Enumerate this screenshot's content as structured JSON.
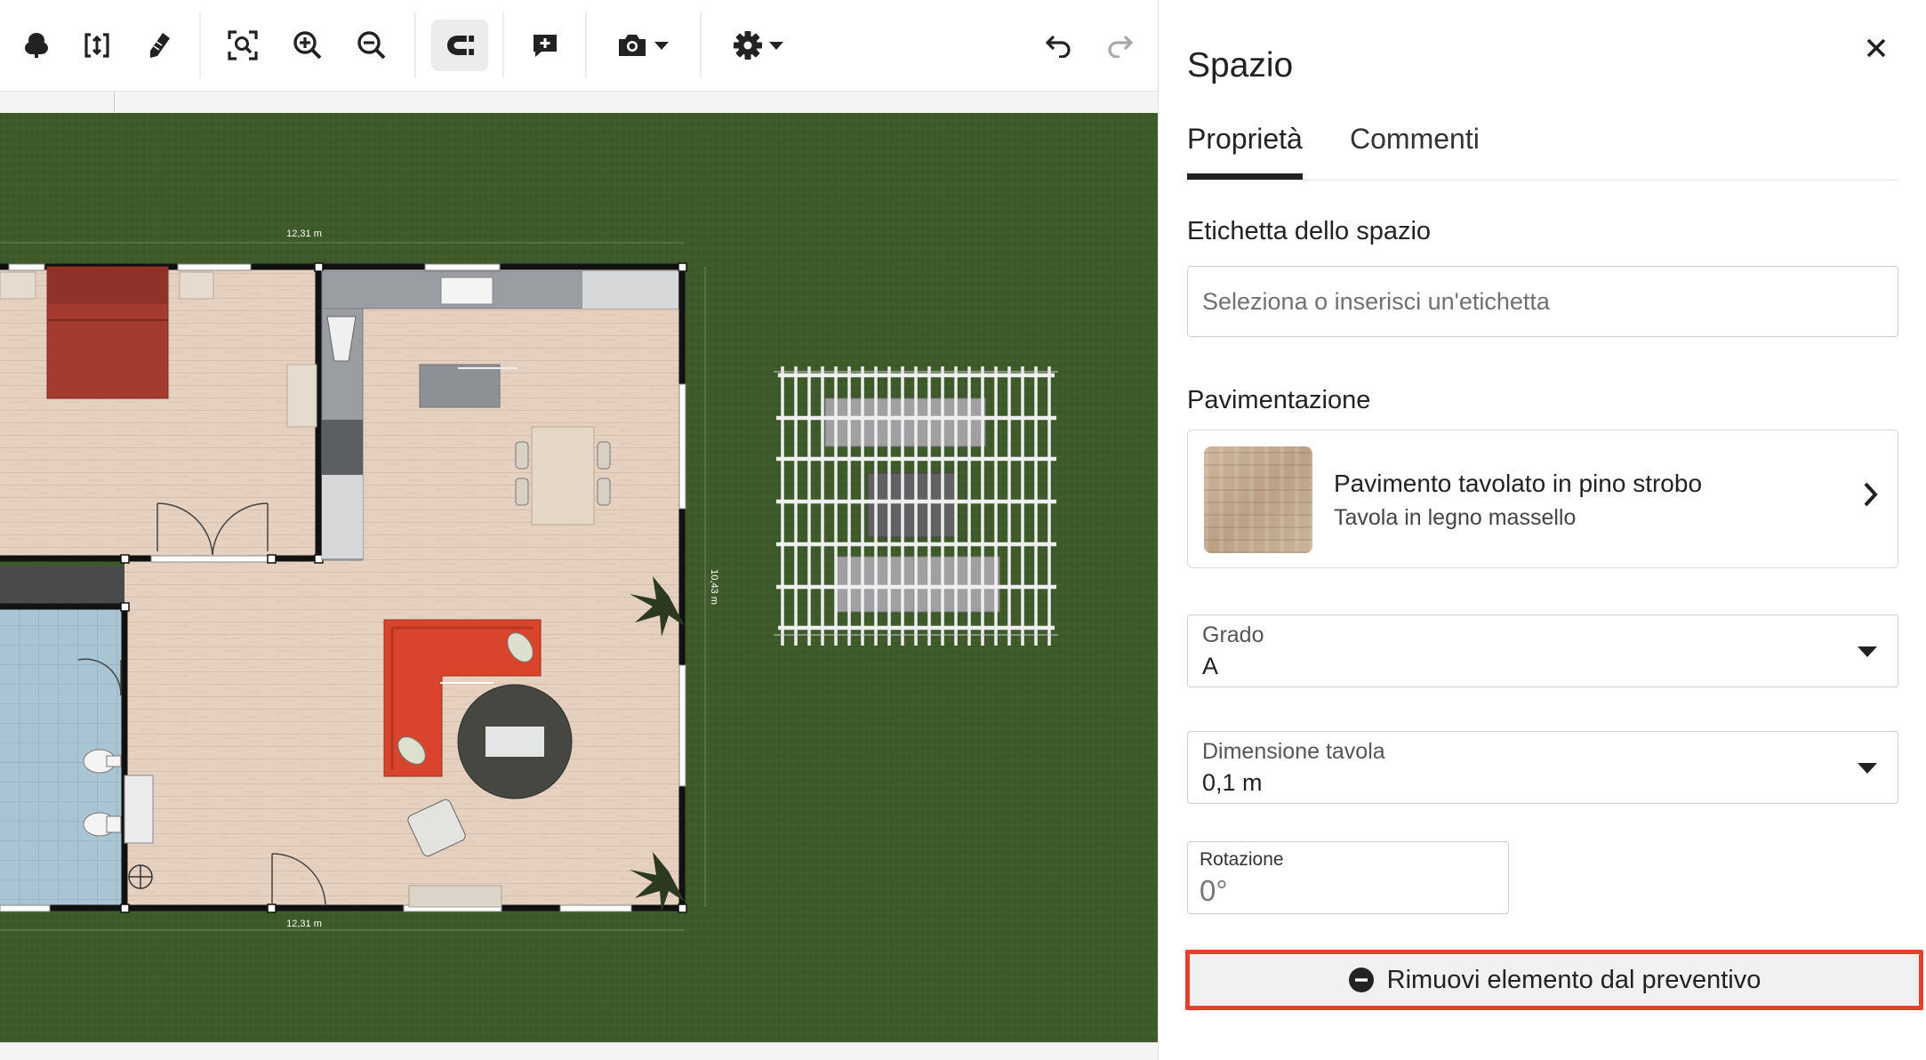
{
  "toolbar": {
    "tools": [
      {
        "icon": "tree-icon"
      },
      {
        "icon": "dimension-icon"
      },
      {
        "icon": "measure-pencil-icon"
      },
      {
        "icon": "zoom-fit-icon"
      },
      {
        "icon": "zoom-in-icon"
      },
      {
        "icon": "zoom-out-icon"
      },
      {
        "icon": "magnet-icon",
        "active": true
      },
      {
        "icon": "add-comment-icon"
      },
      {
        "icon": "camera-icon"
      },
      {
        "icon": "settings-icon"
      },
      {
        "icon": "undo-icon"
      },
      {
        "icon": "redo-icon"
      }
    ]
  },
  "plan": {
    "dim_top": "12,31 m",
    "dim_bottom": "12,31 m",
    "dim_right": "10,43 m",
    "colors": {
      "grass": "#3d5a29",
      "floor": "#e6d1c1",
      "wall": "#111111",
      "bathroom_tile": "#a9c4d2",
      "sofa": "#d8452c",
      "bed": "#a33b31"
    }
  },
  "panel": {
    "title": "Spazio",
    "tabs": [
      {
        "label": "Proprietà",
        "active": true
      },
      {
        "label": "Commenti",
        "active": false
      }
    ],
    "label_section": {
      "title": "Etichetta dello spazio",
      "placeholder": "Seleziona o inserisci un'etichetta"
    },
    "flooring": {
      "title": "Pavimentazione",
      "name": "Pavimento tavolato in pino strobo",
      "description": "Tavola in legno massello"
    },
    "grade": {
      "label": "Grado",
      "value": "A"
    },
    "board_size": {
      "label": "Dimensione tavola",
      "value": "0,1 m"
    },
    "rotation": {
      "label": "Rotazione",
      "value": "0°"
    },
    "remove_button": {
      "label": "Rimuovi elemento dal preventivo"
    },
    "accent_color": "#e2412b"
  }
}
